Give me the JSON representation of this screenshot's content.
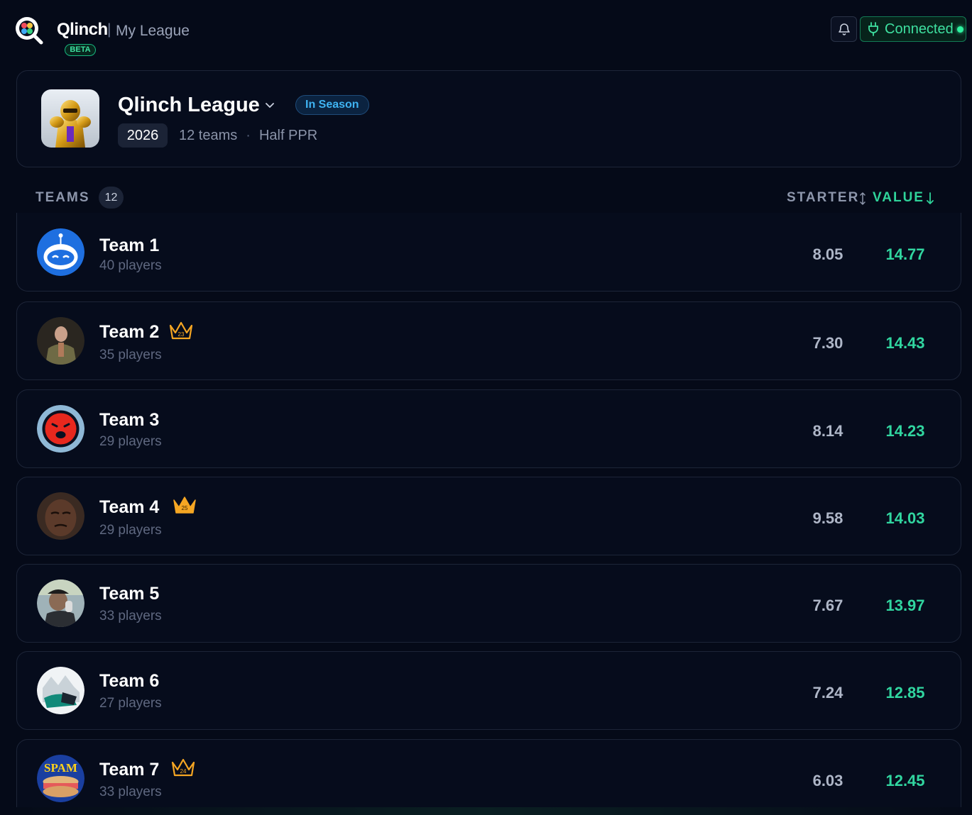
{
  "header": {
    "brand": "Qlinch",
    "separator": "|",
    "section": "My League",
    "beta_label": "BETA",
    "connection_label": "Connected",
    "accent_color": "#2fd39a"
  },
  "league": {
    "name": "Qlinch League",
    "status": "In Season",
    "year": "2026",
    "team_count_label": "12 teams",
    "meta_separator": "·",
    "scoring": "Half PPR"
  },
  "teams_header": {
    "label": "TEAMS",
    "count": "12",
    "sort_starter": "STARTER",
    "sort_value": "VALUE"
  },
  "teams": [
    {
      "name": "Team 1",
      "players": "40 players",
      "starter": "8.05",
      "value": "14.77",
      "crown": ""
    },
    {
      "name": "Team 2",
      "players": "35 players",
      "starter": "7.30",
      "value": "14.43",
      "crown": "23"
    },
    {
      "name": "Team 3",
      "players": "29 players",
      "starter": "8.14",
      "value": "14.23",
      "crown": ""
    },
    {
      "name": "Team 4",
      "players": "29 players",
      "starter": "9.58",
      "value": "14.03",
      "crown": "25"
    },
    {
      "name": "Team 5",
      "players": "33 players",
      "starter": "7.67",
      "value": "13.97",
      "crown": ""
    },
    {
      "name": "Team 6",
      "players": "27 players",
      "starter": "7.24",
      "value": "12.85",
      "crown": ""
    },
    {
      "name": "Team 7",
      "players": "33 players",
      "starter": "6.03",
      "value": "12.45",
      "crown": "24"
    }
  ],
  "avatar_labels": {
    "team7": "SPAM"
  }
}
